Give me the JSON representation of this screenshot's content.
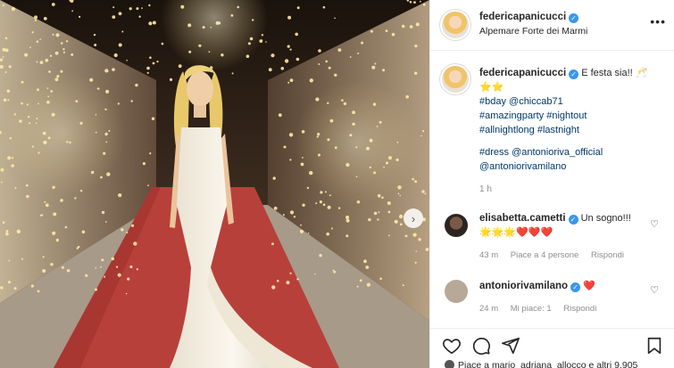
{
  "post": {
    "author": "federicapanicucci",
    "location": "Alpemare Forte dei Marmi",
    "more_icon": "more-horizontal-icon",
    "caption": {
      "author": "federicapanicucci",
      "line1": "E festa sia!!",
      "line1_emoji": "🥂",
      "line2": "⭐⭐",
      "line3": "#bday @chiccab71",
      "line4": "#amazingparty #nightout",
      "line5": "#allnightlong #lastnight",
      "line6": "#dress @antonioriva_official",
      "line7": "@antoniorivamilano",
      "time": "1 h"
    },
    "comments": [
      {
        "user": "elisabetta.cametti",
        "text": "Un sogno!!!",
        "emoji_line": "🌟🌟🌟❤️❤️❤️",
        "time": "43 m",
        "likes": "Piace a 4 persone",
        "reply": "Rispondi"
      },
      {
        "user": "antoniorivamilano",
        "text": "❤️",
        "time": "24 m",
        "likes": "Mi piace: 1",
        "reply": "Rispondi"
      }
    ],
    "likes_text": "Piace a mario_adriana_allocco e altri 9.905"
  },
  "colors": {
    "carpet": "#b8403a",
    "verified": "#3897f0",
    "link": "#00376b",
    "muted": "#8e8e8e",
    "heart_red": "#ed4956"
  }
}
